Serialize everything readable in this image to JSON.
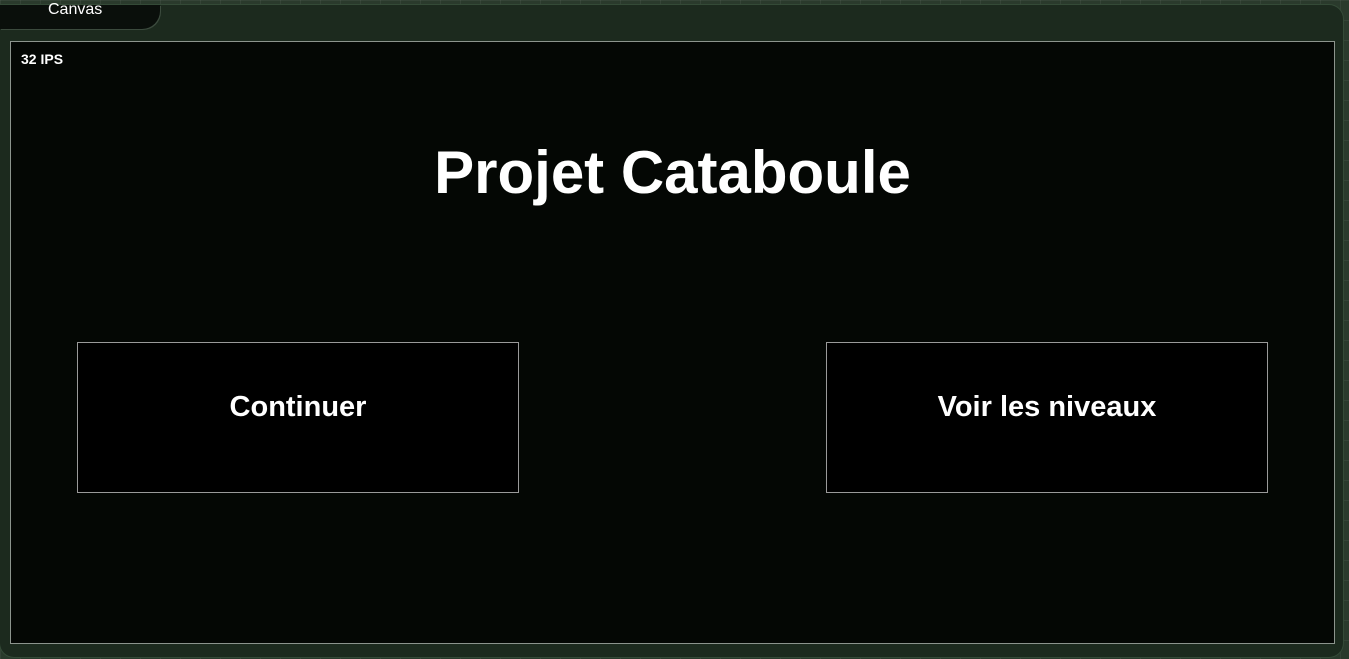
{
  "tab": {
    "label": "Canvas"
  },
  "canvas": {
    "fps_label": "32 IPS",
    "title": "Projet Cataboule",
    "buttons": {
      "continue_label": "Continuer",
      "levels_label": "Voir les niveaux"
    }
  },
  "colors": {
    "page_background": "#2a3a2c",
    "canvas_background": "#040704",
    "text": "#ffffff",
    "button_border": "#9a9a9a"
  }
}
